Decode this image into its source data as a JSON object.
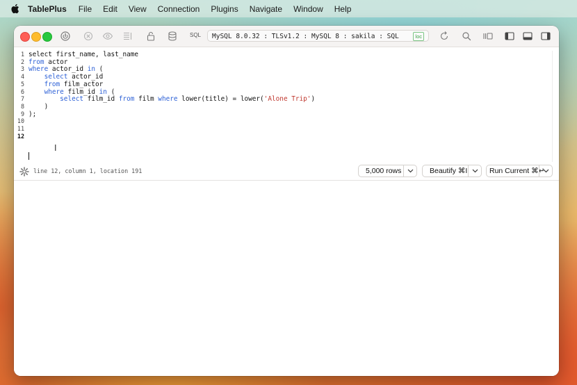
{
  "menubar": {
    "app_name": "TablePlus",
    "items": [
      "File",
      "Edit",
      "View",
      "Connection",
      "Plugins",
      "Navigate",
      "Window",
      "Help"
    ]
  },
  "toolbar": {
    "sql_label": "SQL",
    "connection": "MySQL 8.0.32 : TLSv1.2 : MySQL 8 : sakila : SQL",
    "env_badge": "loc"
  },
  "editor": {
    "lines": [
      {
        "num": "1",
        "tokens": [
          {
            "t": "select first_name, last_name",
            "c": "plain"
          }
        ]
      },
      {
        "num": "2",
        "tokens": [
          {
            "t": "from",
            "c": "kw"
          },
          {
            "t": " actor",
            "c": "plain"
          }
        ]
      },
      {
        "num": "3",
        "tokens": [
          {
            "t": "where",
            "c": "kw"
          },
          {
            "t": " actor_id ",
            "c": "plain"
          },
          {
            "t": "in",
            "c": "kw"
          },
          {
            "t": " (",
            "c": "plain"
          }
        ]
      },
      {
        "num": "4",
        "tokens": [
          {
            "t": "    ",
            "c": "plain"
          },
          {
            "t": "select",
            "c": "kw"
          },
          {
            "t": " actor_id",
            "c": "plain"
          }
        ]
      },
      {
        "num": "5",
        "tokens": [
          {
            "t": "    ",
            "c": "plain"
          },
          {
            "t": "from",
            "c": "kw"
          },
          {
            "t": " film_actor",
            "c": "plain"
          }
        ]
      },
      {
        "num": "6",
        "tokens": [
          {
            "t": "    ",
            "c": "plain"
          },
          {
            "t": "where",
            "c": "kw"
          },
          {
            "t": " film_id ",
            "c": "plain"
          },
          {
            "t": "in",
            "c": "kw"
          },
          {
            "t": " (",
            "c": "plain"
          }
        ]
      },
      {
        "num": "7",
        "tokens": [
          {
            "t": "        ",
            "c": "plain"
          },
          {
            "t": "select",
            "c": "kw"
          },
          {
            "t": " film_id ",
            "c": "plain"
          },
          {
            "t": "from",
            "c": "kw"
          },
          {
            "t": " film ",
            "c": "plain"
          },
          {
            "t": "where",
            "c": "kw"
          },
          {
            "t": " lower(title) = lower(",
            "c": "plain"
          },
          {
            "t": "'Alone Trip'",
            "c": "str"
          },
          {
            "t": ")",
            "c": "plain"
          }
        ]
      },
      {
        "num": "8",
        "tokens": [
          {
            "t": "    )",
            "c": "plain"
          }
        ]
      },
      {
        "num": "9",
        "tokens": [
          {
            "t": ");",
            "c": "plain"
          }
        ]
      },
      {
        "num": "10",
        "tokens": []
      },
      {
        "num": "11",
        "tokens": []
      },
      {
        "num": "12",
        "tokens": []
      }
    ],
    "current_line": "12"
  },
  "status": {
    "position": "line 12, column 1, location 191",
    "rows_limit": "5,000 rows",
    "beautify": "Beautify ⌘I",
    "run": "Run Current ⌘↵"
  },
  "colors": {
    "keyword": "#2b5fd6",
    "string": "#c0382f",
    "env_badge": "#3ea34b"
  }
}
